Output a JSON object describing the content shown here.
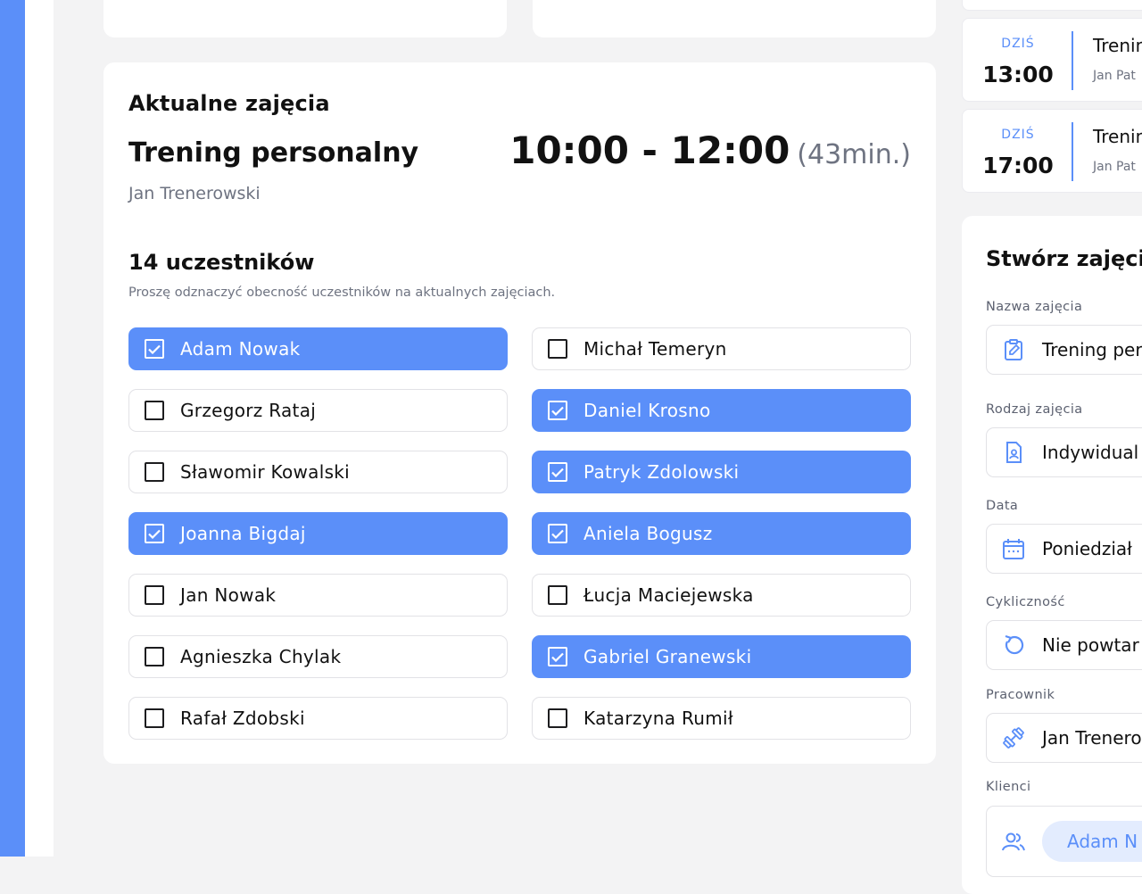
{
  "current_class": {
    "section_title": "Aktualne zajęcia",
    "class_name": "Trening personalny",
    "trainer": "Jan Trenerowski",
    "time_range": "10:00 - 12:00",
    "time_left": "(43min.)",
    "participants_count": "14 uczestników",
    "participants_hint": "Proszę odznaczyć obecność uczestników na aktualnych zajęciach."
  },
  "attendance": [
    {
      "name": "Adam Nowak",
      "checked": true
    },
    {
      "name": "Michał Temeryn",
      "checked": false
    },
    {
      "name": "Grzegorz Rataj",
      "checked": false
    },
    {
      "name": "Daniel Krosno",
      "checked": true
    },
    {
      "name": "Sławomir Kowalski",
      "checked": false
    },
    {
      "name": "Patryk Zdolowski",
      "checked": true
    },
    {
      "name": "Joanna Bigdaj",
      "checked": true
    },
    {
      "name": "Aniela Bogusz",
      "checked": true
    },
    {
      "name": "Jan Nowak",
      "checked": false
    },
    {
      "name": "Łucja Maciejewska",
      "checked": false
    },
    {
      "name": "Agnieszka Chylak",
      "checked": false
    },
    {
      "name": "Gabriel Granewski",
      "checked": true
    },
    {
      "name": "Rafał Zdobski",
      "checked": false
    },
    {
      "name": "Katarzyna Rumił",
      "checked": false
    }
  ],
  "upcoming": [
    {
      "day": "DZIŚ",
      "hour": "13:00",
      "title": "Trenin",
      "subtitle": "Jan Pat"
    },
    {
      "day": "DZIŚ",
      "hour": "17:00",
      "title": "Trenin",
      "subtitle": "Jan Pat"
    }
  ],
  "create_form": {
    "title": "Stwórz zajęci",
    "fields": {
      "name": {
        "label": "Nazwa zajęcia",
        "value": "Trening per",
        "icon": "clipboard-edit-icon"
      },
      "type": {
        "label": "Rodzaj zajęcia",
        "value": "Indywidual",
        "icon": "document-user-icon"
      },
      "date": {
        "label": "Data",
        "value": "Poniedział",
        "icon": "calendar-icon"
      },
      "recurrence": {
        "label": "Cykliczność",
        "value": "Nie powtar",
        "icon": "repeat-icon"
      },
      "employee": {
        "label": "Pracownik",
        "value": "Jan Trenero",
        "icon": "dumbbell-icon"
      },
      "clients": {
        "label": "Klienci",
        "value": "Adam N",
        "icon": "users-icon"
      }
    }
  },
  "colors": {
    "accent": "#5b8ff9",
    "muted": "#6e7381",
    "background": "#f3f3f4"
  }
}
